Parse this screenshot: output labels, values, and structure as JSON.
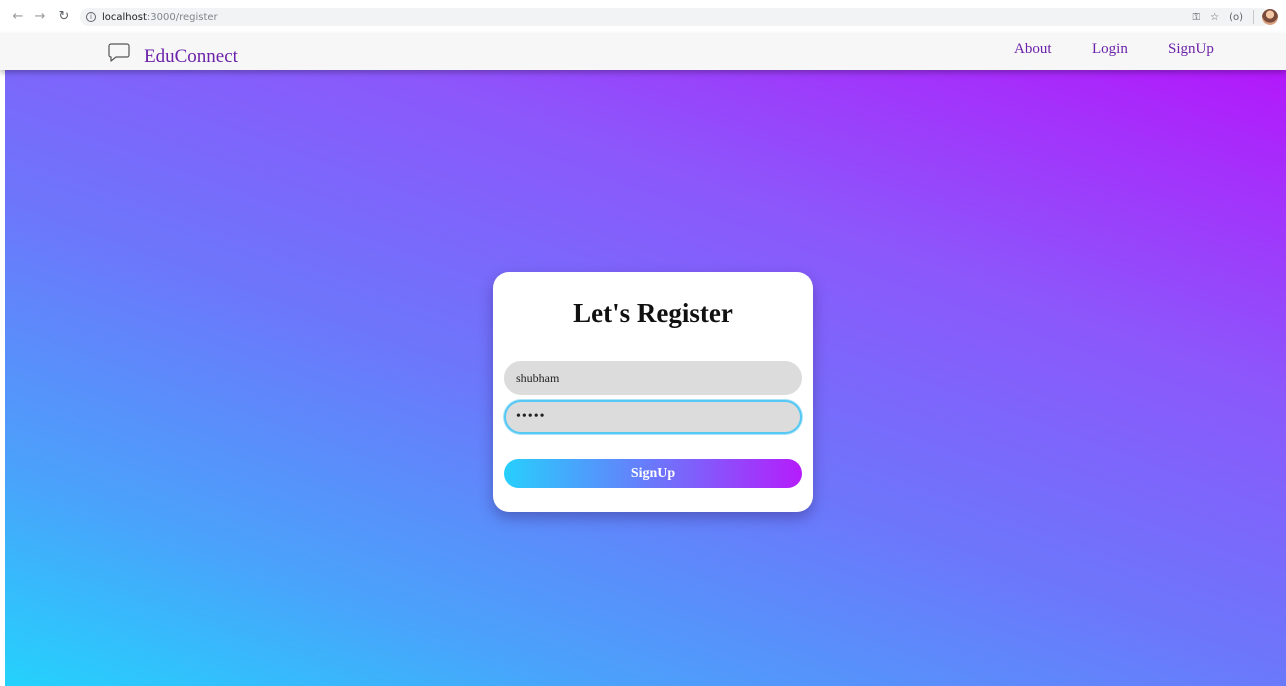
{
  "browser": {
    "url_host": "localhost",
    "url_path": ":3000/register"
  },
  "navbar": {
    "brand": "EduConnect",
    "links": {
      "about": "About",
      "login": "Login",
      "signup": "SignUp"
    }
  },
  "form": {
    "title": "Let's Register",
    "username_value": "shubham",
    "password_value": "12345",
    "submit_label": "SignUp"
  },
  "colors": {
    "brand": "#6b21a8",
    "gradient_start": "#24d2fc",
    "gradient_end": "#b318fb",
    "focus_ring": "#56c8f4"
  }
}
